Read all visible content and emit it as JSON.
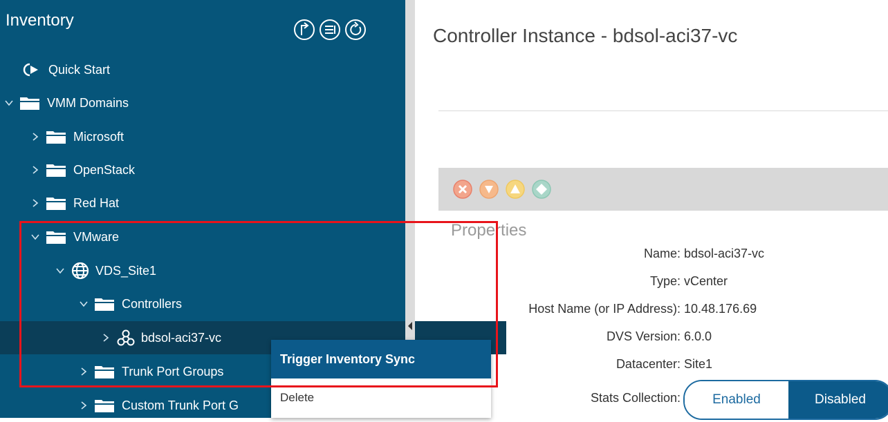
{
  "sidebar": {
    "title": "Inventory",
    "header_icons": [
      "collapse-up-icon",
      "list-icon",
      "refresh-icon"
    ],
    "items": [
      {
        "label": "Quick Start",
        "icon": "quick-start-icon"
      },
      {
        "label": "VMM Domains",
        "icon": "folder-icon",
        "expanded": true
      },
      {
        "label": "Microsoft",
        "icon": "folder-icon",
        "expanded": false
      },
      {
        "label": "OpenStack",
        "icon": "folder-icon",
        "expanded": false
      },
      {
        "label": "Red Hat",
        "icon": "folder-icon",
        "expanded": false
      },
      {
        "label": "VMware",
        "icon": "folder-icon",
        "expanded": true
      },
      {
        "label": "VDS_Site1",
        "icon": "globe-icon",
        "expanded": true
      },
      {
        "label": "Controllers",
        "icon": "folder-icon",
        "expanded": true
      },
      {
        "label": "bdsol-aci37-vc",
        "icon": "vcenter-icon",
        "expanded": false,
        "selected": true
      },
      {
        "label": "Trunk Port Groups",
        "icon": "folder-icon",
        "expanded": false
      },
      {
        "label": "Custom Trunk Port G",
        "icon": "folder-icon",
        "expanded": false
      }
    ]
  },
  "main": {
    "title": "Controller Instance - bdsol-aci37-vc",
    "fault_icons": [
      "critical-fault-icon",
      "major-fault-icon",
      "minor-fault-icon",
      "warning-fault-icon"
    ],
    "properties_title": "Properties",
    "properties": [
      {
        "label": "Name:",
        "value": "bdsol-aci37-vc"
      },
      {
        "label": "Type:",
        "value": "vCenter"
      },
      {
        "label": "Host Name (or IP Address):",
        "value": "10.48.176.69"
      },
      {
        "label": "DVS Version:",
        "value": "6.0.0"
      },
      {
        "label": "Datacenter:",
        "value": "Site1"
      },
      {
        "label": "Stats Collection:",
        "value": ""
      }
    ],
    "stats_toggle": {
      "enabled_label": "Enabled",
      "disabled_label": "Disabled",
      "selected": "Disabled"
    }
  },
  "context_menu": {
    "items": [
      "Trigger Inventory Sync",
      "Delete"
    ],
    "active": "Trigger Inventory Sync"
  },
  "colors": {
    "sidebar_bg": "#06557a",
    "selected_row": "#0b3e58",
    "accent": "#0c5a8a",
    "highlight": "#e8141b"
  }
}
